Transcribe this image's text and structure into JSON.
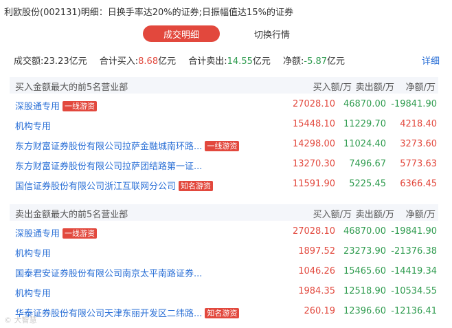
{
  "title": "利欧股份(002131)明细：日换手率达20%的证券;日振幅值达15%的证券",
  "tabs": {
    "active": "成交明细",
    "inactive": "切换行情"
  },
  "summary": {
    "turnover_label": "成交额:",
    "turnover_value": "23.23亿元",
    "buy_label": "合计买入:",
    "buy_value": "8.68",
    "buy_unit": "亿元",
    "sell_label": "合计卖出:",
    "sell_value": "14.55",
    "sell_unit": "亿元",
    "net_label": "净额:",
    "net_value": "-5.87",
    "net_unit": "亿元",
    "detail": "详细"
  },
  "columns": {
    "buy": "买入额/万",
    "sell": "卖出额/万",
    "net": "净额/万"
  },
  "buy_section": {
    "title": "买入金额最大的前5名营业部",
    "rows": [
      {
        "name": "深股通专用",
        "badge": "一线游资",
        "buy": "27028.10",
        "sell": "46870.00",
        "net": "-19841.90"
      },
      {
        "name": "机构专用",
        "badge": "",
        "buy": "15448.10",
        "sell": "11229.70",
        "net": "4218.40"
      },
      {
        "name": "东方财富证券股份有限公司拉萨金融城南环路...",
        "badge": "一线游资",
        "buy": "14298.00",
        "sell": "11024.40",
        "net": "3273.60"
      },
      {
        "name": "东方财富证券股份有限公司拉萨团结路第一证...",
        "badge": "",
        "buy": "13270.30",
        "sell": "7496.67",
        "net": "5773.63"
      },
      {
        "name": "国信证券股份有限公司浙江互联网分公司",
        "badge": "知名游资",
        "buy": "11591.90",
        "sell": "5225.45",
        "net": "6366.45"
      }
    ]
  },
  "sell_section": {
    "title": "卖出金额最大的前5名营业部",
    "rows": [
      {
        "name": "深股通专用",
        "badge": "一线游资",
        "buy": "27028.10",
        "sell": "46870.00",
        "net": "-19841.90"
      },
      {
        "name": "机构专用",
        "badge": "",
        "buy": "1897.52",
        "sell": "23273.90",
        "net": "-21376.38"
      },
      {
        "name": "国泰君安证券股份有限公司南京太平南路证券...",
        "badge": "",
        "buy": "1046.26",
        "sell": "15465.60",
        "net": "-14419.34"
      },
      {
        "name": "机构专用",
        "badge": "",
        "buy": "1984.35",
        "sell": "12518.90",
        "net": "-10534.55"
      },
      {
        "name": "华泰证券股份有限公司天津东丽开发区二纬路...",
        "badge": "知名游资",
        "buy": "260.19",
        "sell": "12396.60",
        "net": "-12136.41"
      }
    ]
  },
  "watermark": "© 大智慧"
}
